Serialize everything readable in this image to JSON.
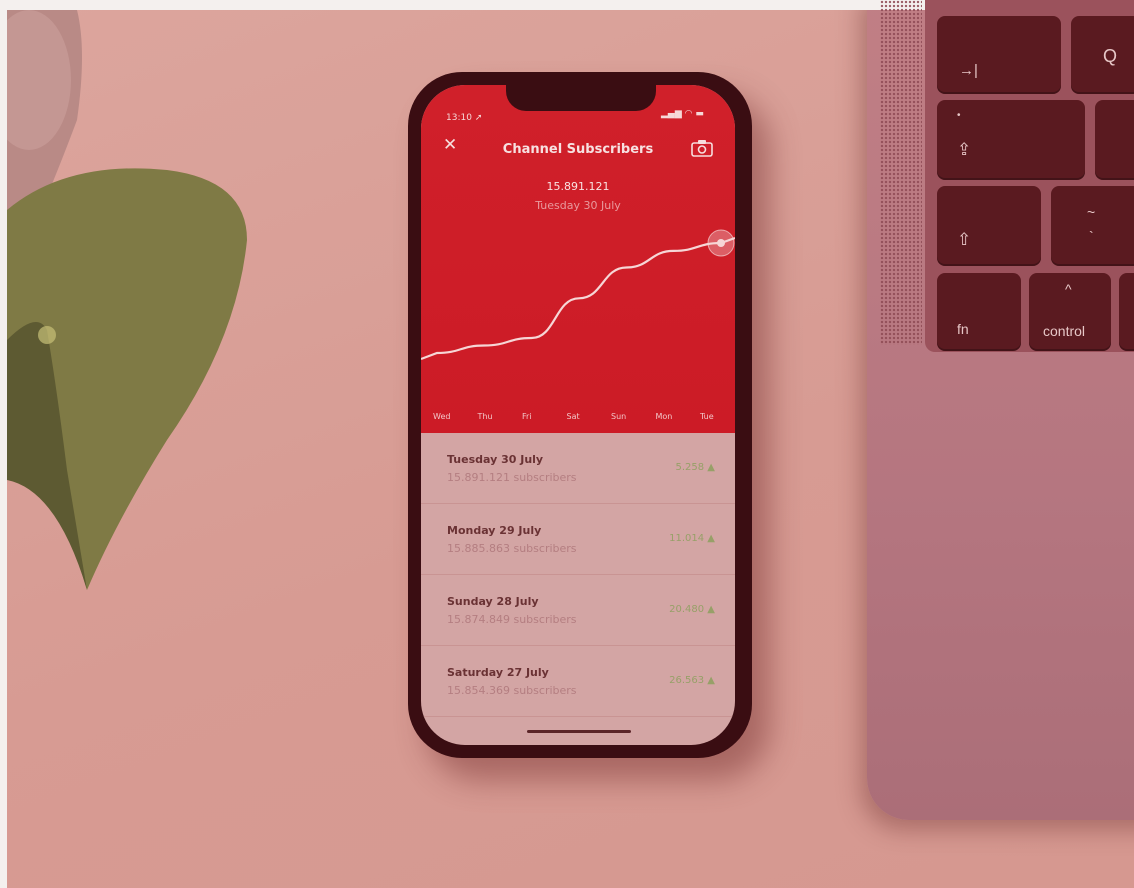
{
  "app": {
    "status_time": "13:10",
    "title": "Channel Subscribers",
    "selected_value": "15.891.121",
    "selected_date": "Tuesday 30 July",
    "icons": [
      "close-icon",
      "camera-icon",
      "location-arrow-icon",
      "signal-icon",
      "wifi-icon",
      "battery-icon"
    ]
  },
  "chart_data": {
    "type": "line",
    "x": [
      "Wed",
      "Thu",
      "Fri",
      "Sat",
      "Sun",
      "Mon",
      "Tue"
    ],
    "series": [
      {
        "values": [
          15818000,
          15823000,
          15828000,
          15854369,
          15874849,
          15885863,
          15891121
        ]
      }
    ],
    "highlight_index": 6,
    "colors": {
      "background": "#cd1d28",
      "line": "#f6d6d6"
    }
  },
  "list": [
    {
      "day": "Tuesday 30 July",
      "subscribers": "15.891.121 subscribers",
      "change": "5.258"
    },
    {
      "day": "Monday 29 July",
      "subscribers": "15.885.863 subscribers",
      "change": "11.014"
    },
    {
      "day": "Sunday 28 July",
      "subscribers": "15.874.849 subscribers",
      "change": "20.480"
    },
    {
      "day": "Saturday 27 July",
      "subscribers": "15.854.369 subscribers",
      "change": "26.563"
    }
  ],
  "change_suffix": "▲",
  "laptop_keys": {
    "tab": "→|",
    "q": "Q",
    "caps": "⇪",
    "shift": "⇧",
    "tilde": "~",
    "backtick": "`",
    "fn": "fn",
    "caret": "^",
    "control": "control"
  }
}
